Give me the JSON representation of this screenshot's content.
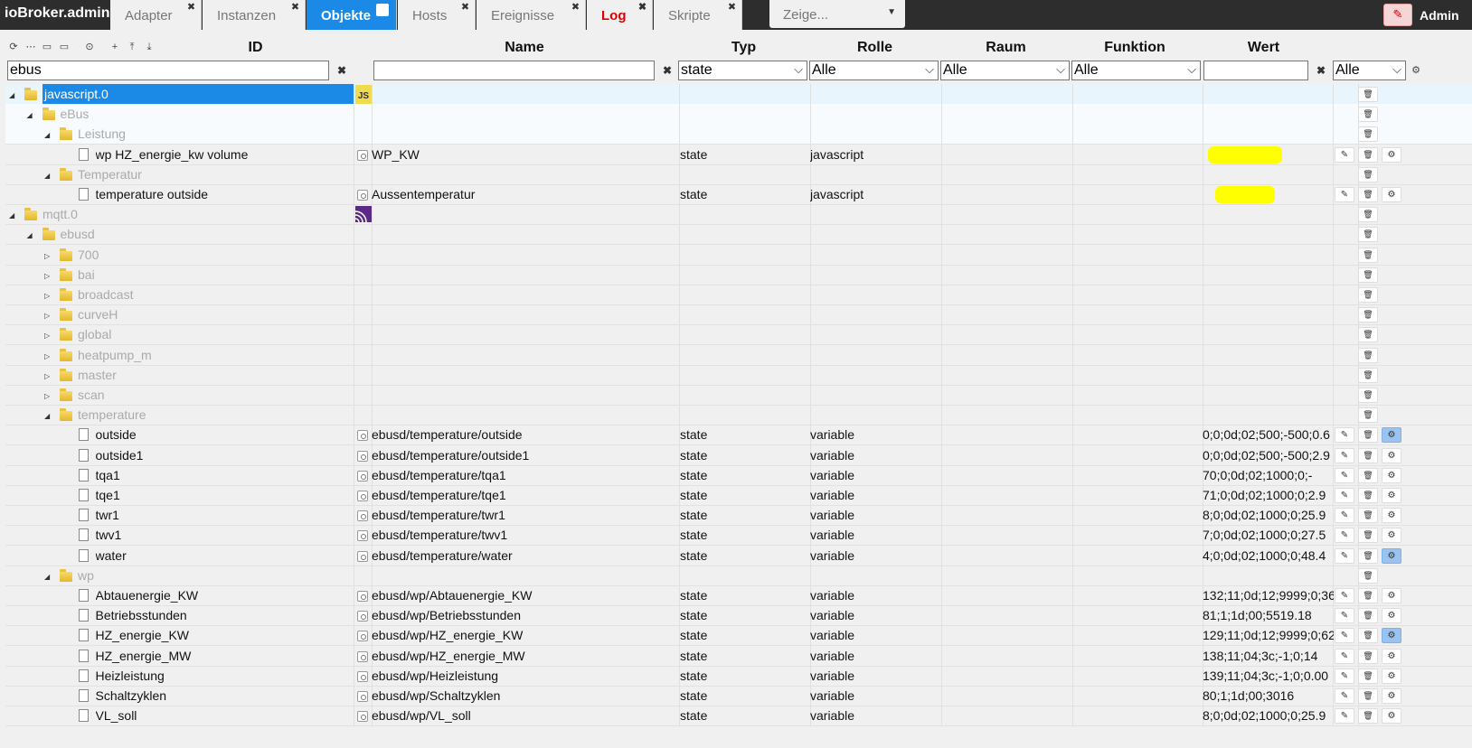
{
  "app": {
    "title": "ioBroker.admin",
    "tabs": [
      {
        "label": "Adapter"
      },
      {
        "label": "Instanzen"
      },
      {
        "label": "Objekte"
      },
      {
        "label": "Hosts"
      },
      {
        "label": "Ereignisse"
      },
      {
        "label": "Log"
      },
      {
        "label": "Skripte"
      }
    ],
    "zeige": "Zeige...",
    "admin_label": "Admin"
  },
  "columns": {
    "id": "ID",
    "name": "Name",
    "typ": "Typ",
    "rolle": "Rolle",
    "raum": "Raum",
    "funktion": "Funktion",
    "wert": "Wert"
  },
  "filters": {
    "id_value": "ebus",
    "name_value": "",
    "typ": "state",
    "rolle": "Alle",
    "raum": "Alle",
    "funktion": "Alle",
    "wert_value": "",
    "extra": "Alle"
  },
  "rows": [
    {
      "id": "javascript.0",
      "name": "",
      "typ": "",
      "rolle": "",
      "wert": ""
    },
    {
      "id": "eBus",
      "name": "",
      "typ": "",
      "rolle": "",
      "wert": ""
    },
    {
      "id": "Leistung",
      "name": "",
      "typ": "",
      "rolle": "",
      "wert": ""
    },
    {
      "id": "wp HZ_energie_kw volume",
      "name": "WP_KW",
      "typ": "state",
      "rolle": "javascript",
      "wert": ""
    },
    {
      "id": "Temperatur",
      "name": "",
      "typ": "",
      "rolle": "",
      "wert": ""
    },
    {
      "id": "temperature outside",
      "name": "Aussentemperatur",
      "typ": "state",
      "rolle": "javascript",
      "wert": ""
    },
    {
      "id": "mqtt.0",
      "name": "",
      "typ": "",
      "rolle": "",
      "wert": ""
    },
    {
      "id": "ebusd",
      "name": "",
      "typ": "",
      "rolle": "",
      "wert": ""
    },
    {
      "id": "700",
      "name": "",
      "typ": "",
      "rolle": "",
      "wert": ""
    },
    {
      "id": "bai",
      "name": "",
      "typ": "",
      "rolle": "",
      "wert": ""
    },
    {
      "id": "broadcast",
      "name": "",
      "typ": "",
      "rolle": "",
      "wert": ""
    },
    {
      "id": "curveH",
      "name": "",
      "typ": "",
      "rolle": "",
      "wert": ""
    },
    {
      "id": "global",
      "name": "",
      "typ": "",
      "rolle": "",
      "wert": ""
    },
    {
      "id": "heatpump_m",
      "name": "",
      "typ": "",
      "rolle": "",
      "wert": ""
    },
    {
      "id": "master",
      "name": "",
      "typ": "",
      "rolle": "",
      "wert": ""
    },
    {
      "id": "scan",
      "name": "",
      "typ": "",
      "rolle": "",
      "wert": ""
    },
    {
      "id": "temperature",
      "name": "",
      "typ": "",
      "rolle": "",
      "wert": ""
    },
    {
      "id": "outside",
      "name": "ebusd/temperature/outside",
      "typ": "state",
      "rolle": "variable",
      "wert": "0;0;0d;02;500;-500;0.6"
    },
    {
      "id": "outside1",
      "name": "ebusd/temperature/outside1",
      "typ": "state",
      "rolle": "variable",
      "wert": "0;0;0d;02;500;-500;2.9"
    },
    {
      "id": "tqa1",
      "name": "ebusd/temperature/tqa1",
      "typ": "state",
      "rolle": "variable",
      "wert": "70;0;0d;02;1000;0;-"
    },
    {
      "id": "tqe1",
      "name": "ebusd/temperature/tqe1",
      "typ": "state",
      "rolle": "variable",
      "wert": "71;0;0d;02;1000;0;2.9"
    },
    {
      "id": "twr1",
      "name": "ebusd/temperature/twr1",
      "typ": "state",
      "rolle": "variable",
      "wert": "8;0;0d;02;1000;0;25.9"
    },
    {
      "id": "twv1",
      "name": "ebusd/temperature/twv1",
      "typ": "state",
      "rolle": "variable",
      "wert": "7;0;0d;02;1000;0;27.5"
    },
    {
      "id": "water",
      "name": "ebusd/temperature/water",
      "typ": "state",
      "rolle": "variable",
      "wert": "4;0;0d;02;1000;0;48.4"
    },
    {
      "id": "wp",
      "name": "",
      "typ": "",
      "rolle": "",
      "wert": ""
    },
    {
      "id": "Abtauenergie_KW",
      "name": "ebusd/wp/Abtauenergie_KW",
      "typ": "state",
      "rolle": "variable",
      "wert": "132;11;0d;12;9999;0;36"
    },
    {
      "id": "Betriebsstunden",
      "name": "ebusd/wp/Betriebsstunden",
      "typ": "state",
      "rolle": "variable",
      "wert": "81;1;1d;00;5519.18"
    },
    {
      "id": "HZ_energie_KW",
      "name": "ebusd/wp/HZ_energie_KW",
      "typ": "state",
      "rolle": "variable",
      "wert": "129;11;0d;12;9999;0;62"
    },
    {
      "id": "HZ_energie_MW",
      "name": "ebusd/wp/HZ_energie_MW",
      "typ": "state",
      "rolle": "variable",
      "wert": "138;11;04;3c;-1;0;14"
    },
    {
      "id": "Heizleistung",
      "name": "ebusd/wp/Heizleistung",
      "typ": "state",
      "rolle": "variable",
      "wert": "139;11;04;3c;-1;0;0.00"
    },
    {
      "id": "Schaltzyklen",
      "name": "ebusd/wp/Schaltzyklen",
      "typ": "state",
      "rolle": "variable",
      "wert": "80;1;1d;00;3016"
    },
    {
      "id": "VL_soll",
      "name": "ebusd/wp/VL_soll",
      "typ": "state",
      "rolle": "variable",
      "wert": "8;0;0d;02;1000;0;25.9"
    }
  ]
}
